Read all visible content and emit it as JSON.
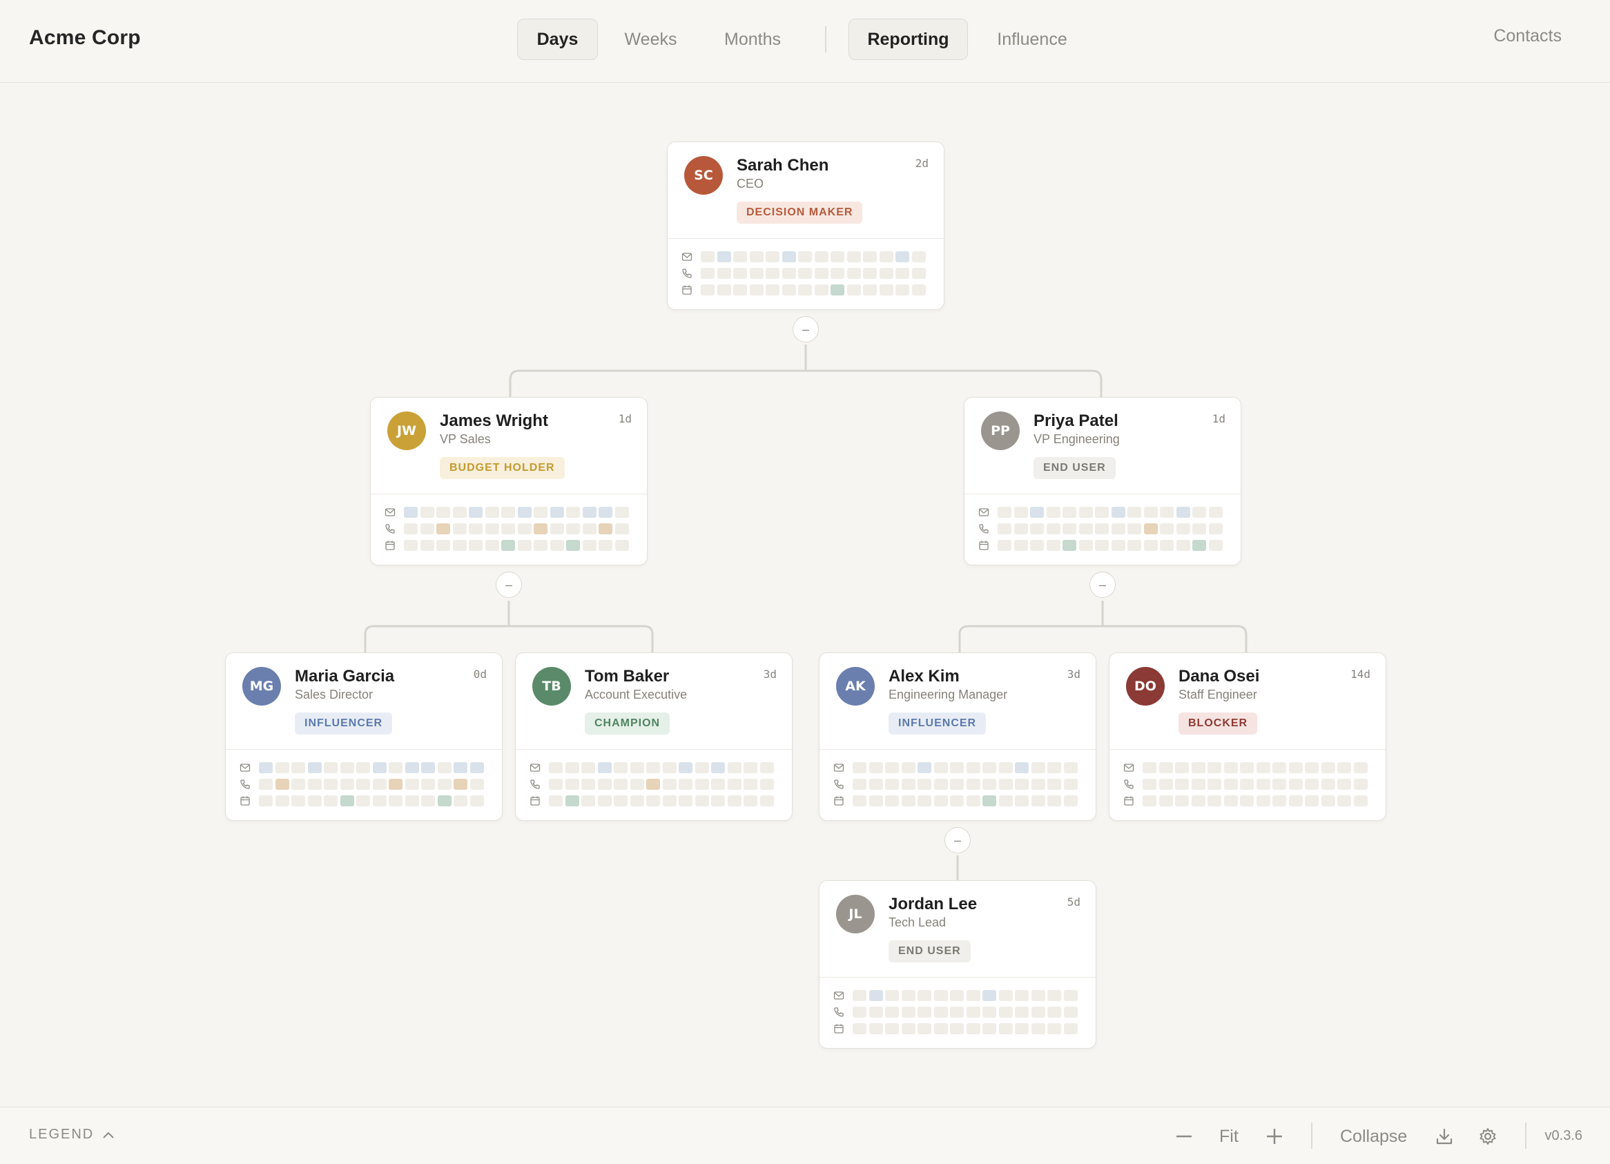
{
  "brand": "Acme Corp",
  "timeframe_tabs": [
    {
      "label": "Days",
      "active": true
    },
    {
      "label": "Weeks",
      "active": false
    },
    {
      "label": "Months",
      "active": false
    }
  ],
  "view_tabs": [
    {
      "label": "Reporting",
      "active": true
    },
    {
      "label": "Influence",
      "active": false
    }
  ],
  "contacts_label": "Contacts",
  "role_styles": {
    "DECISION MAKER": {
      "fg": "#b65a3c",
      "bg": "#f8e7e1"
    },
    "BUDGET HOLDER": {
      "fg": "#c49a30",
      "bg": "#f8f0dc"
    },
    "END USER": {
      "fg": "#7c7972",
      "bg": "#f0efeb"
    },
    "INFLUENCER": {
      "fg": "#5b79ad",
      "bg": "#e8edf5"
    },
    "CHAMPION": {
      "fg": "#4f8462",
      "bg": "#e5f0e8"
    },
    "BLOCKER": {
      "fg": "#8e3a34",
      "bg": "#f6e4e2"
    }
  },
  "activity_colors": {
    "empty": "#efede6",
    "email": "#d9e2ea",
    "call": "#e7d3b8",
    "meeting": "#c5d9ce"
  },
  "people": [
    {
      "id": "sarah-chen",
      "initials": "SC",
      "name": "Sarah Chen",
      "title": "CEO",
      "age": "2d",
      "role": "DECISION MAKER",
      "avatar_color": "#b7583a",
      "activity": {
        "email": [
          1,
          5,
          12
        ],
        "call": [],
        "meeting": [
          8
        ]
      }
    },
    {
      "id": "james-wright",
      "initials": "JW",
      "name": "James Wright",
      "title": "VP Sales",
      "age": "1d",
      "role": "BUDGET HOLDER",
      "avatar_color": "#c9a136",
      "activity": {
        "email": [
          0,
          4,
          7,
          9,
          11,
          12
        ],
        "call": [
          2,
          8,
          12
        ],
        "meeting": [
          6,
          10
        ]
      }
    },
    {
      "id": "priya-patel",
      "initials": "PP",
      "name": "Priya Patel",
      "title": "VP Engineering",
      "age": "1d",
      "role": "END USER",
      "avatar_color": "#9a958e",
      "activity": {
        "email": [
          2,
          7,
          11
        ],
        "call": [
          9
        ],
        "meeting": [
          4,
          12
        ]
      }
    },
    {
      "id": "maria-garcia",
      "initials": "MG",
      "name": "Maria Garcia",
      "title": "Sales Director",
      "age": "0d",
      "role": "INFLUENCER",
      "avatar_color": "#6a7fae",
      "activity": {
        "email": [
          0,
          3,
          7,
          9,
          10,
          12,
          13
        ],
        "call": [
          1,
          8,
          12
        ],
        "meeting": [
          5,
          11
        ]
      }
    },
    {
      "id": "tom-baker",
      "initials": "TB",
      "name": "Tom Baker",
      "title": "Account Executive",
      "age": "3d",
      "role": "CHAMPION",
      "avatar_color": "#5a8a69",
      "activity": {
        "email": [
          3,
          8,
          10
        ],
        "call": [
          6
        ],
        "meeting": [
          1
        ]
      }
    },
    {
      "id": "alex-kim",
      "initials": "AK",
      "name": "Alex Kim",
      "title": "Engineering Manager",
      "age": "3d",
      "role": "INFLUENCER",
      "avatar_color": "#6a7fae",
      "activity": {
        "email": [
          4,
          10
        ],
        "call": [],
        "meeting": [
          8
        ]
      }
    },
    {
      "id": "dana-osei",
      "initials": "DO",
      "name": "Dana Osei",
      "title": "Staff Engineer",
      "age": "14d",
      "role": "BLOCKER",
      "avatar_color": "#8b3a35",
      "activity": {
        "email": [],
        "call": [],
        "meeting": []
      }
    },
    {
      "id": "jordan-lee",
      "initials": "JL",
      "name": "Jordan Lee",
      "title": "Tech Lead",
      "age": "5d",
      "role": "END USER",
      "avatar_color": "#9a958e",
      "activity": {
        "email": [
          1,
          8
        ],
        "call": [],
        "meeting": []
      }
    }
  ],
  "footer": {
    "legend_label": "LEGEND",
    "fit_label": "Fit",
    "collapse_label": "Collapse",
    "version": "v0.3.6"
  }
}
